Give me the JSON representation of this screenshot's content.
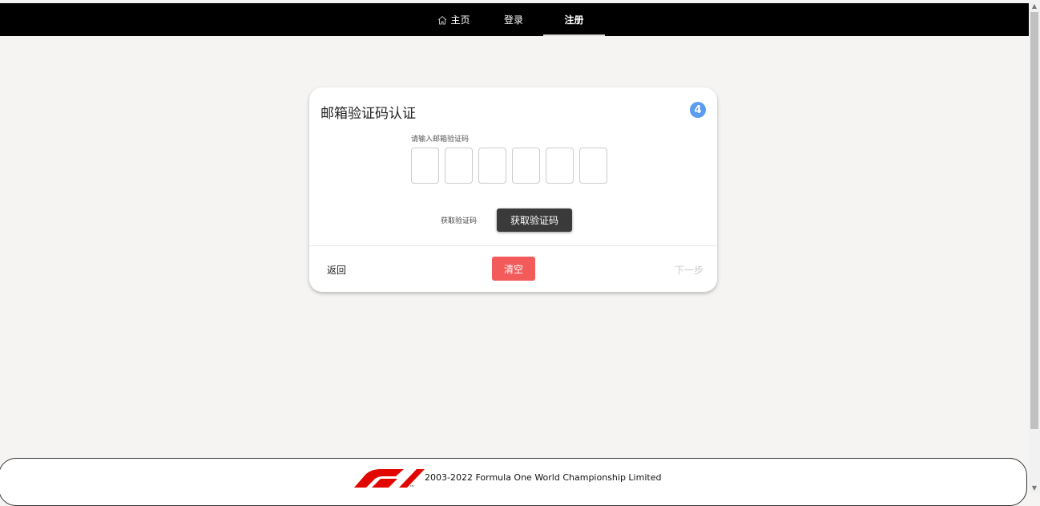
{
  "nav": {
    "home_label": "主页",
    "login_label": "登录",
    "register_label": "注册",
    "active": "注册"
  },
  "card": {
    "title": "邮箱验证码认证",
    "step_number": "4",
    "code_label": "请输入邮箱验证码",
    "code_values": [
      "",
      "",
      "",
      "",
      "",
      ""
    ],
    "get_code_label": "获取验证码",
    "get_code_button": "获取验证码",
    "back_label": "返回",
    "clear_label": "清空",
    "next_label": "下一步"
  },
  "footer": {
    "copyright": "2003-2022 Formula One World Championship Limited"
  },
  "colors": {
    "nav_bg": "#000000",
    "page_bg": "#f5f4f2",
    "step_badge": "#5b9cf1",
    "clear_button": "#f35a5a",
    "get_code_button": "#3a3a3a",
    "f1_red": "#e10600"
  },
  "icons": {
    "home": "home-icon",
    "logo": "f1-logo"
  }
}
